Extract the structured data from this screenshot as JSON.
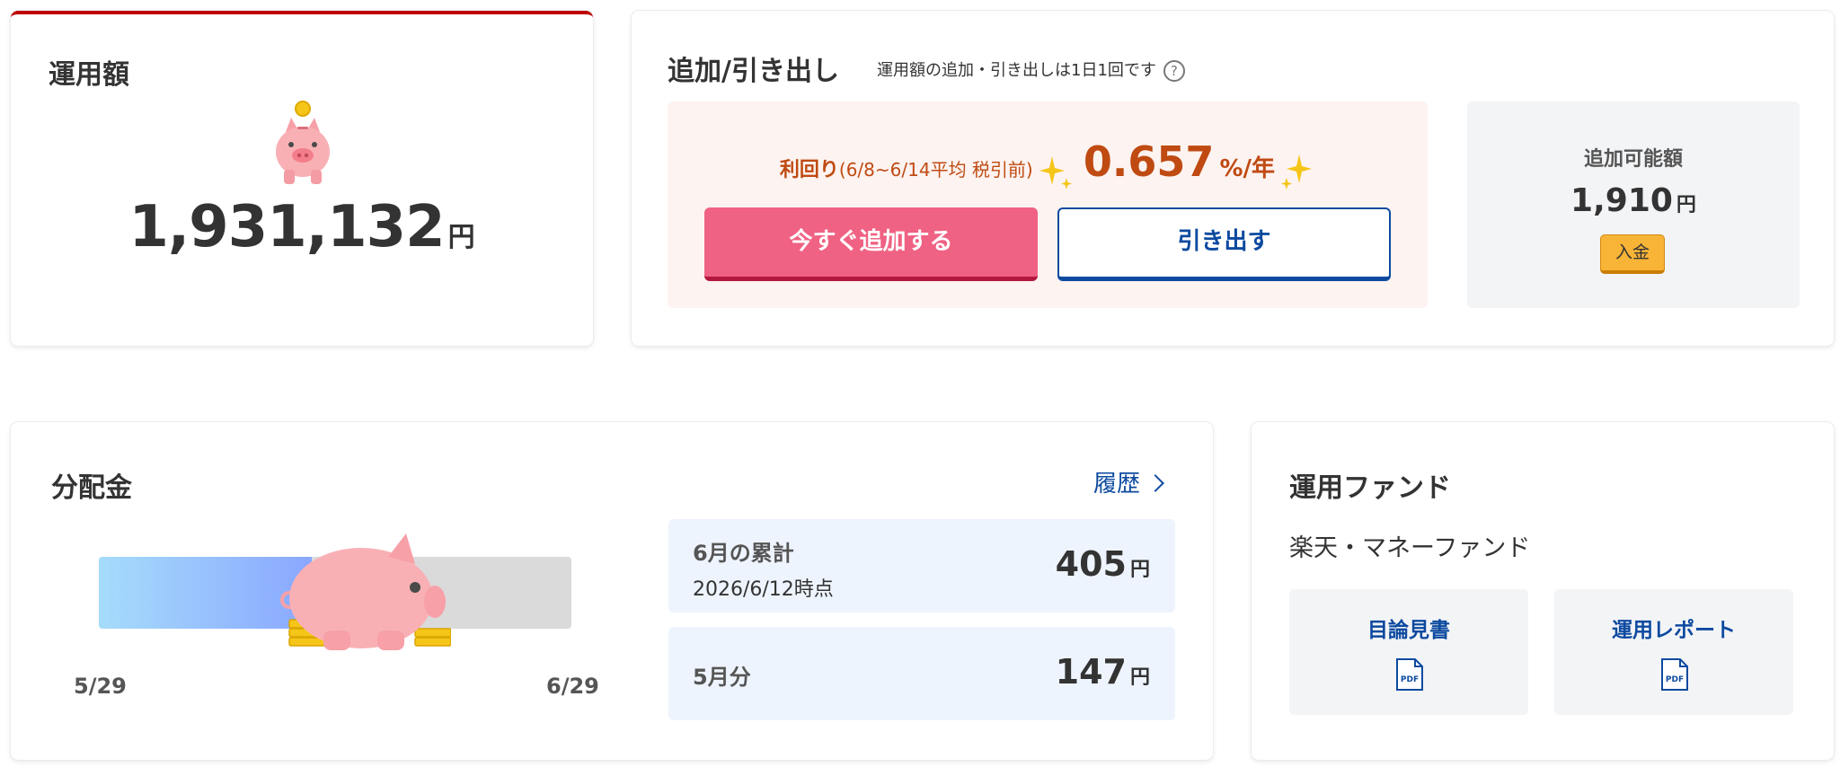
{
  "balance_card": {
    "title": "運用額",
    "amount": "1,931,132",
    "unit": "円"
  },
  "add_withdraw_card": {
    "title": "追加/引き出し",
    "note": "運用額の追加・引き出しは1日1回です",
    "help_icon": "?",
    "yield_label": "利回り",
    "yield_period": "(6/8~6/14平均 税引前)",
    "yield_rate": "0.657",
    "yield_unit": "%/年",
    "add_button": "今すぐ追加する",
    "withdraw_button": "引き出す",
    "available_label": "追加可能額",
    "available_amount": "1,910",
    "available_unit": "円",
    "deposit_button": "入金",
    "colors": {
      "accent_red": "#bf0000",
      "add_button": "#f06283",
      "link_blue": "#0d4aa0",
      "deposit": "#f8b436"
    }
  },
  "distribution_card": {
    "title": "分配金",
    "history_link": "履歴",
    "start_date": "5/29",
    "end_date": "6/29",
    "progress_fraction": 0.45,
    "month_total_label": "6月の累計",
    "month_total_date": "2026/6/12時点",
    "month_total_amount": "405",
    "prev_month_label": "5月分",
    "prev_month_amount": "147",
    "unit": "円"
  },
  "fund_card": {
    "title": "運用ファンド",
    "fund_name": "楽天・マネーファンド",
    "prospectus_label": "目論見書",
    "report_label": "運用レポート",
    "pdf_text": "PDF"
  }
}
